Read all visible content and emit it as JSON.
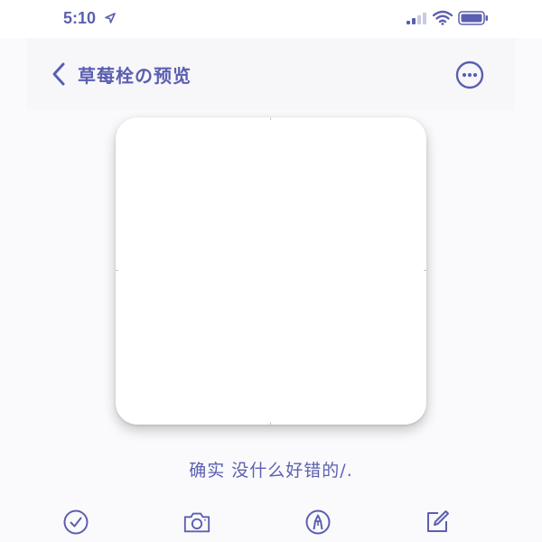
{
  "status_bar": {
    "time": "5:10",
    "icons": [
      "location-arrow-icon",
      "cellular-signal-icon",
      "wifi-icon",
      "battery-icon"
    ]
  },
  "nav": {
    "title": "草莓栓の预览",
    "back_icon": "chevron-left-icon",
    "more_icon": "more-horizontal-icon"
  },
  "preview": {
    "caption": "确实  没什么好错的/."
  },
  "toolbar": {
    "items": [
      {
        "icon": "checkmark-circle-icon"
      },
      {
        "icon": "camera-icon"
      },
      {
        "icon": "pen-circle-icon"
      },
      {
        "icon": "compose-icon"
      }
    ]
  },
  "colors": {
    "accent": "#5b5fb0",
    "background": "#fafafc",
    "card": "#ffffff"
  }
}
